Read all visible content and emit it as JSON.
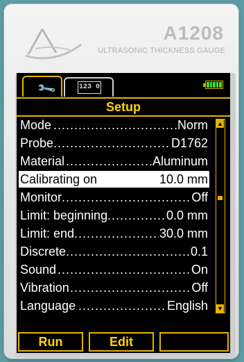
{
  "device": {
    "model": "A1208",
    "tagline": "ULTRASONIC THICKNESS GAUGE"
  },
  "tabs": {
    "active_icon": "wrench-icon",
    "inactive_icon": "counter-icon",
    "counter_text": "123 0"
  },
  "status": {
    "battery_level": 1.0,
    "battery_color": "#3ddc2a"
  },
  "screen_title": "Setup",
  "settings": [
    {
      "label": "Mode",
      "value": "Norm"
    },
    {
      "label": "Probe",
      "value": "D1762"
    },
    {
      "label": "Material",
      "value": "Aluminum"
    },
    {
      "label": "Calibrating on",
      "value": "10.0 mm"
    },
    {
      "label": "Monitor",
      "value": "Off"
    },
    {
      "label": "Limit: beginning",
      "value": "0.0 mm"
    },
    {
      "label": "Limit: end",
      "value": "30.0 mm"
    },
    {
      "label": "Discrete",
      "value": "0.1"
    },
    {
      "label": "Sound",
      "value": "On"
    },
    {
      "label": "Vibration",
      "value": "Off"
    },
    {
      "label": "Language",
      "value": "English"
    }
  ],
  "selected_index": 3,
  "softkeys": {
    "left": "Run",
    "middle": "Edit",
    "right": ""
  },
  "colors": {
    "accent": "#e6b300",
    "title_text": "#ffd400",
    "background": "#000000"
  }
}
